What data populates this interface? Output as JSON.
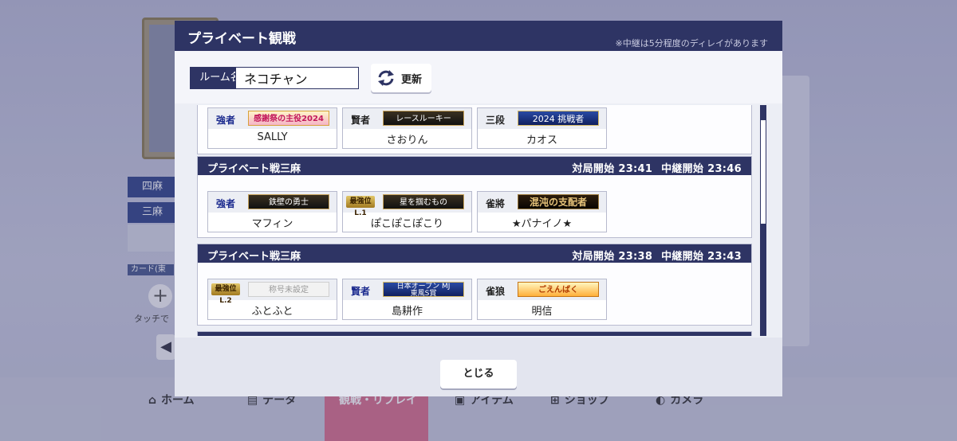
{
  "modal": {
    "title": "プライベート観戦",
    "note": "※中継は5分程度のディレイがあります",
    "room_label": "ルーム名",
    "room_value": "ネコチャン",
    "refresh_label": "更新",
    "close_label": "とじる"
  },
  "groups": [
    {
      "players": [
        {
          "rank": "強者",
          "title": "感謝祭の主役2024",
          "name": "SALLY"
        },
        {
          "rank": "賢者",
          "title": "レースルーキー",
          "name": "さおりん"
        },
        {
          "rank": "三段",
          "title": "2024 挑戦者",
          "name": "カオス"
        }
      ]
    },
    {
      "title": "プライベート戦三麻",
      "start_label": "対局開始",
      "start_time": "23:41",
      "relay_label": "中継開始",
      "relay_time": "23:46",
      "players": [
        {
          "rank": "強者",
          "title": "鉄壁の勇士",
          "name": "マフィン"
        },
        {
          "rank": "最強位L.1",
          "title": "星を掴むもの",
          "name": "ぽこぽこぽこり"
        },
        {
          "rank": "雀將",
          "title": "混沌の支配者",
          "name": "★パナイノ★"
        }
      ]
    },
    {
      "title": "プライベート戦三麻",
      "start_label": "対局開始",
      "start_time": "23:38",
      "relay_label": "中継開始",
      "relay_time": "23:43",
      "players": [
        {
          "rank": "最強位L.2",
          "title": "称号未設定",
          "name": "ふとふと"
        },
        {
          "rank": "賢者",
          "title_line1": "日本オープン MJ",
          "title_line2": "東風S賞",
          "name": "島耕作"
        },
        {
          "rank": "雀狼",
          "title": "ごえんばく",
          "name": "明信"
        }
      ]
    }
  ],
  "background": {
    "mode_4": "四麻",
    "mode_3": "三麻",
    "card_label": "カード(東",
    "touch_text": "タッチで",
    "nav": [
      "ホーム",
      "データ",
      "観戦・リプレイ",
      "アイテム",
      "ショップ",
      "カメラ"
    ]
  },
  "colors": {
    "header": "#2e3464",
    "panel": "#eceef5",
    "nav_active": "#d9708e"
  }
}
